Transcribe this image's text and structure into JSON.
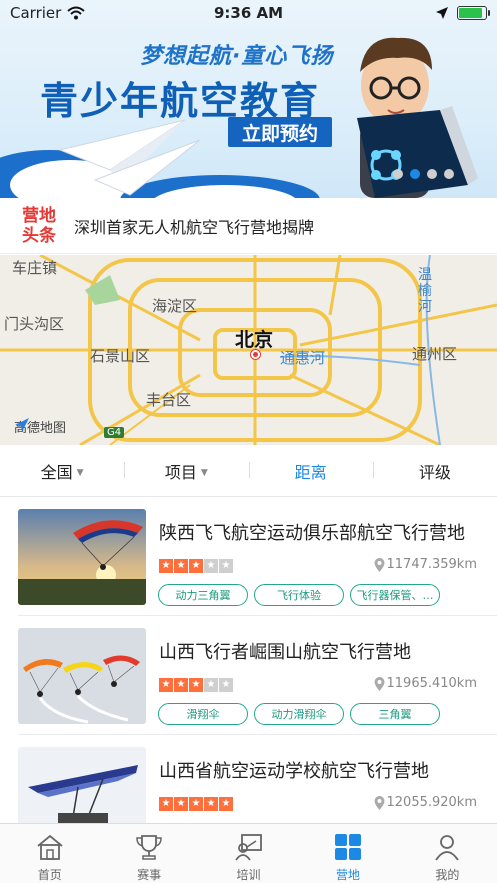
{
  "status_bar": {
    "carrier": "Carrier",
    "time": "9:36 AM",
    "battery_level": 0.9
  },
  "banner": {
    "slogan": "梦想起航·童心飞扬",
    "title": "青少年航空教育",
    "cta_label": "立即预约",
    "page_count": 4,
    "active_page": 2
  },
  "headline": {
    "badge_line1": "营地",
    "badge_line2": "头条",
    "text": "深圳首家无人机航空飞行营地揭牌"
  },
  "map": {
    "labels": {
      "top_left": "车庄镇",
      "haidian": "海淀区",
      "mentougou": "门头沟区",
      "shijingshan": "石景山区",
      "city": "北京",
      "tonghui_river": "通惠河",
      "tongzhou": "通州区",
      "fengtai": "丰台区",
      "wenyu_river": "温榆河",
      "highway": "G4"
    },
    "provider": "高德地图"
  },
  "filters": [
    {
      "label": "全国",
      "has_caret": true,
      "active": false
    },
    {
      "label": "项目",
      "has_caret": true,
      "active": false
    },
    {
      "label": "距离",
      "has_caret": false,
      "active": true
    },
    {
      "label": "评级",
      "has_caret": false,
      "active": false
    }
  ],
  "camps": [
    {
      "title": "陕西飞飞航空运动俱乐部航空飞行营地",
      "rating": 3,
      "max_rating": 5,
      "distance": "11747.359km",
      "tags": [
        "动力三角翼",
        "飞行体验",
        "飞行器保管、…"
      ]
    },
    {
      "title": "山西飞行者崛围山航空飞行营地",
      "rating": 3,
      "max_rating": 5,
      "distance": "11965.410km",
      "tags": [
        "滑翔伞",
        "动力滑翔伞",
        "三角翼"
      ]
    },
    {
      "title": "山西省航空运动学校航空飞行营地",
      "rating": 5,
      "max_rating": 5,
      "distance": "12055.920km",
      "tags": []
    }
  ],
  "tabs": [
    {
      "label": "首页",
      "icon": "home-icon",
      "active": false
    },
    {
      "label": "赛事",
      "icon": "trophy-icon",
      "active": false
    },
    {
      "label": "培训",
      "icon": "training-icon",
      "active": false
    },
    {
      "label": "营地",
      "icon": "camp-grid-icon",
      "active": true
    },
    {
      "label": "我的",
      "icon": "profile-icon",
      "active": false
    }
  ],
  "colors": {
    "accent": "#1e88e5",
    "tag": "#21a88a",
    "star": "#ff6f3c",
    "headline_badge": "#e53935"
  }
}
